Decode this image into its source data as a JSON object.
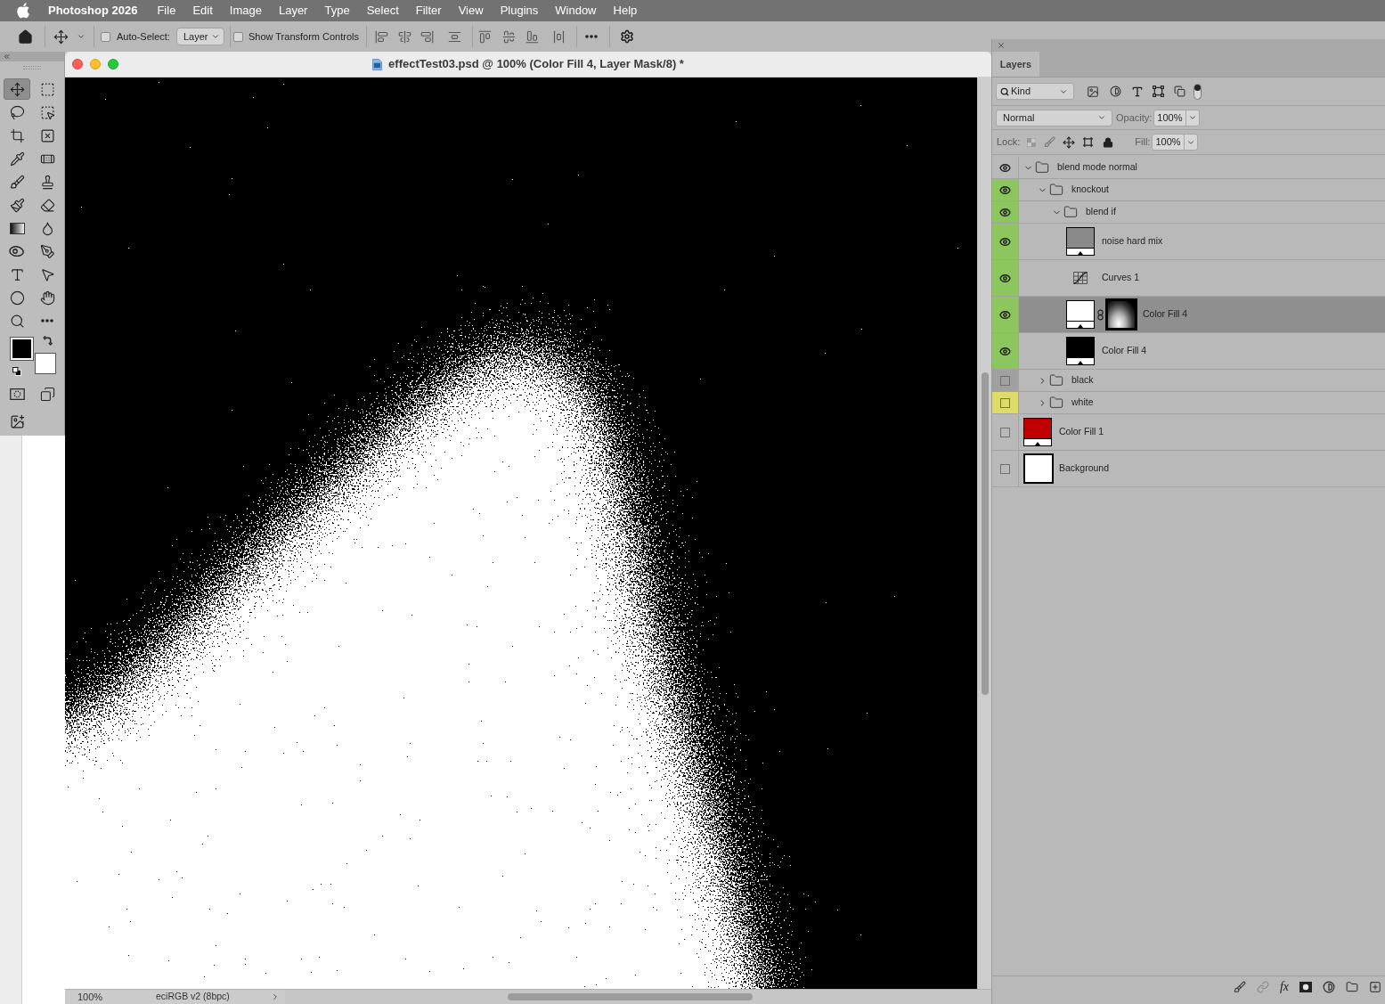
{
  "menu_bar": {
    "app_name": "Photoshop 2026",
    "items": [
      "File",
      "Edit",
      "Image",
      "Layer",
      "Type",
      "Select",
      "Filter",
      "View",
      "Plugins",
      "Window",
      "Help"
    ]
  },
  "options_bar": {
    "auto_select": {
      "label": "Auto-Select:",
      "checked": false
    },
    "target": "Layer",
    "transform_controls": {
      "label": "Show Transform Controls",
      "checked": false
    }
  },
  "tools": [
    {
      "kind": "move",
      "selected": true
    },
    {
      "kind": "marquee",
      "selected": false
    },
    {
      "kind": "lasso",
      "selected": false
    },
    {
      "kind": "object_select",
      "selected": false
    },
    {
      "kind": "crop",
      "selected": false
    },
    {
      "kind": "frame",
      "selected": false
    },
    {
      "kind": "eyedropper",
      "selected": false
    },
    {
      "kind": "healing",
      "selected": false
    },
    {
      "kind": "brush",
      "selected": false
    },
    {
      "kind": "stamp",
      "selected": false
    },
    {
      "kind": "history_brush",
      "selected": false
    },
    {
      "kind": "eraser",
      "selected": false
    },
    {
      "kind": "gradient",
      "selected": false
    },
    {
      "kind": "blur",
      "selected": false
    },
    {
      "kind": "dodge",
      "selected": false
    },
    {
      "kind": "pen",
      "selected": false
    },
    {
      "kind": "type",
      "selected": false
    },
    {
      "kind": "path_select",
      "selected": false
    },
    {
      "kind": "ellipse",
      "selected": false
    },
    {
      "kind": "hand",
      "selected": false
    },
    {
      "kind": "zoom",
      "selected": false
    },
    {
      "kind": "more",
      "selected": false
    }
  ],
  "swatches": {
    "foreground": {
      "color": "#000000"
    },
    "background": {
      "color": "#ffffff"
    }
  },
  "document": {
    "title": "effectTest03.psd @ 100% (Color Fill 4, Layer Mask/8) *",
    "zoom": "100%",
    "info": "eciRGB v2 (8bpc)"
  },
  "layers_panel": {
    "tab": "Layers",
    "filter": {
      "label": "Kind",
      "enabled": true
    },
    "blend_mode": "Normal",
    "opacity_label": "Opacity:",
    "opacity": "100%",
    "lock_label": "Lock:",
    "fill_label": "Fill:",
    "fill": "100%",
    "effects_label": "fx",
    "layers": [
      {
        "name": "blend mode normal",
        "kind": "group",
        "visible": true,
        "selected": false,
        "expanded": true,
        "children": [
          {
            "name": "knockout",
            "kind": "group",
            "visible": true,
            "selected": false,
            "expanded": true,
            "color": "#8dc55e",
            "children": [
              {
                "name": "blend if",
                "kind": "group",
                "visible": true,
                "selected": false,
                "expanded": true,
                "color": "#8dc55e",
                "children": [
                  {
                    "name": "noise hard mix",
                    "kind": "fill",
                    "visible": true,
                    "selected": false,
                    "color": "#8dc55e",
                    "thumbnail": {
                      "color": "#8a8a8a"
                    },
                    "mask": false
                  },
                  {
                    "name": "Curves 1",
                    "kind": "adjustment",
                    "visible": true,
                    "selected": false,
                    "color": "#8dc55e"
                  },
                  {
                    "name": "Color Fill 4",
                    "kind": "fill",
                    "visible": true,
                    "selected": true,
                    "color": "#8dc55e",
                    "thumbnail": {
                      "color": "#ffffff"
                    },
                    "mask": true
                  },
                  {
                    "name": "Color Fill 4",
                    "kind": "fill",
                    "visible": true,
                    "selected": false,
                    "color": "#8dc55e",
                    "thumbnail": {
                      "color": "#000000"
                    },
                    "mask": false
                  }
                ]
              }
            ]
          },
          {
            "name": "black",
            "kind": "group",
            "visible": false,
            "selected": false,
            "expanded": false,
            "color": "#a0a0a0"
          },
          {
            "name": "white",
            "kind": "group",
            "visible": false,
            "selected": false,
            "expanded": false,
            "color": "#dddb6a"
          }
        ]
      },
      {
        "name": "Color Fill 1",
        "kind": "fill",
        "visible": false,
        "selected": false,
        "thumbnail": {
          "color": "#c00000"
        },
        "mask": false
      },
      {
        "name": "Background",
        "kind": "pixel",
        "visible": false,
        "selected": false,
        "thumbnail": {
          "color": "#ffffff"
        }
      }
    ]
  }
}
